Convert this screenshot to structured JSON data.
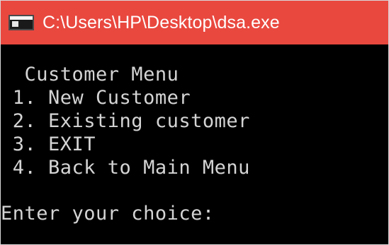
{
  "window": {
    "title": "C:\\Users\\HP\\Desktop\\dsa.exe",
    "title_bar_color": "#e9483f",
    "background_color": "#000000",
    "text_color": "#d4d4d4"
  },
  "console": {
    "menu_title": "  Customer Menu",
    "options": [
      " 1. New Customer",
      " 2. Existing customer",
      " 3. EXIT",
      " 4. Back to Main Menu"
    ],
    "prompt": "Enter your choice:"
  }
}
